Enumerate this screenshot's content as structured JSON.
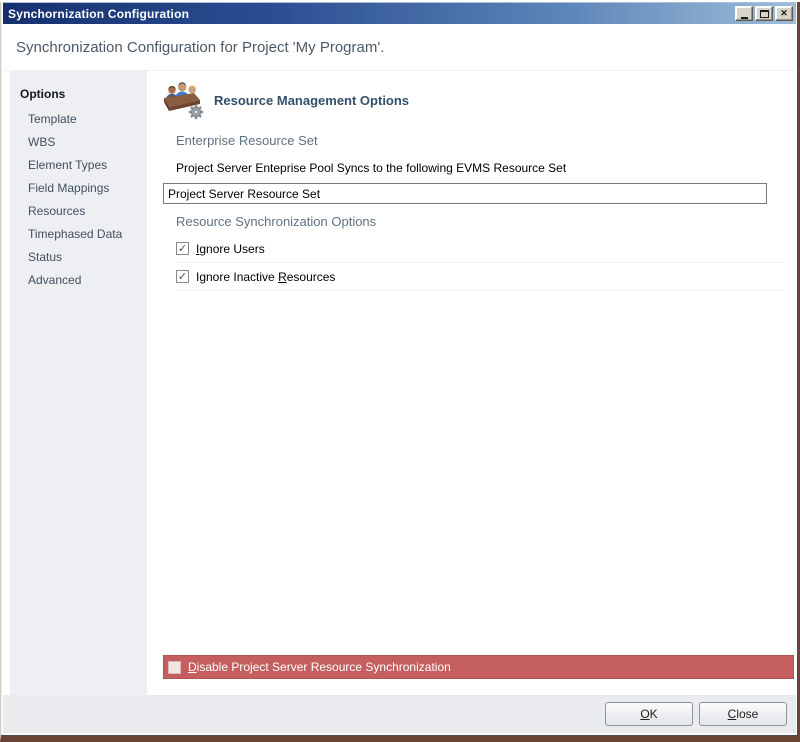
{
  "window": {
    "title": "Synchornization Configuration"
  },
  "header": {
    "title": "Synchronization Configuration for Project 'My Program'."
  },
  "sidebar": {
    "heading": "Options",
    "items": [
      "Template",
      "WBS",
      "Element Types",
      "Field Mappings",
      "Resources",
      "Timephased Data",
      "Status",
      "Advanced"
    ]
  },
  "main": {
    "heading": "Resource Management Options",
    "enterprise": {
      "title": "Enterprise Resource Set",
      "label": "Project Server Enteprise Pool Syncs to the following EVMS Resource Set",
      "input_value": "Project Server Resource Set"
    },
    "sync": {
      "title": "Resource Synchronization Options",
      "option1": {
        "pre": "",
        "key": "I",
        "post": "gnore Users",
        "state": "checked"
      },
      "option2": {
        "pre": "Ignore Inactive ",
        "key": "R",
        "post": "esources",
        "state": "checked"
      }
    },
    "danger": {
      "pre": "",
      "key": "D",
      "post": "isable Project Server Resource Synchronization",
      "state": "unchecked"
    }
  },
  "footer": {
    "ok": {
      "key": "O",
      "post": "K"
    },
    "close": {
      "key": "C",
      "post": "lose"
    }
  },
  "icons": {
    "check_glyph": "✓",
    "close_glyph": "✕",
    "resource_icon": "people-with-gear"
  },
  "colors": {
    "titlebar_start": "#16306e",
    "titlebar_end": "#9dbdd9",
    "danger_bg": "#c55f5f",
    "heading_accent": "#33506b",
    "section_heading": "#5f7282",
    "sidebar_bg": "#edeff3",
    "frame_brown": "#6b4436"
  }
}
